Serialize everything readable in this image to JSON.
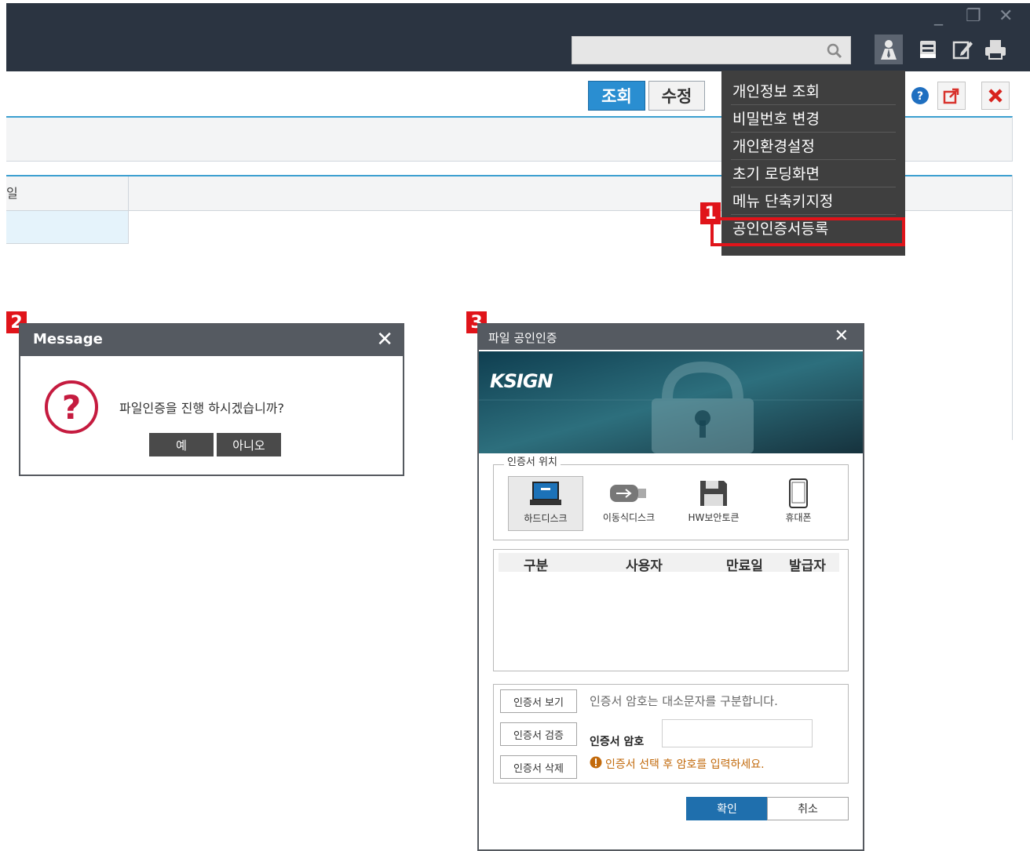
{
  "window_controls": {
    "minimize": "_",
    "restore": "❐",
    "close": "✕"
  },
  "search": {
    "placeholder": ""
  },
  "toolbar": {
    "query_label": "조회",
    "edit_label": "수정"
  },
  "panel": {
    "column_header_partial": "일"
  },
  "user_menu": {
    "items": [
      {
        "label": "개인정보 조회"
      },
      {
        "label": "비밀번호 변경"
      },
      {
        "label": "개인환경설정"
      },
      {
        "label": "초기 로딩화면"
      },
      {
        "label": "메뉴 단축키지정"
      },
      {
        "label": "공인인증서등록"
      }
    ]
  },
  "steps": {
    "one": "1",
    "two": "2",
    "three": "3"
  },
  "message_dialog": {
    "title": "Message",
    "close": "✕",
    "text": "파일인증을 진행 하시겠습니까?",
    "yes_label": "예",
    "no_label": "아니오"
  },
  "cert_dialog": {
    "title": "파일 공인인증",
    "close": "✕",
    "logo": "KSIGN",
    "location_legend": "인증서 위치",
    "locations": [
      {
        "label": "하드디스크",
        "icon": "laptop-icon",
        "selected": true
      },
      {
        "label": "이동식디스크",
        "icon": "usb-icon",
        "selected": false
      },
      {
        "label": "HW보안토큰",
        "icon": "floppy-icon",
        "selected": false
      },
      {
        "label": "휴대폰",
        "icon": "phone-icon",
        "selected": false
      }
    ],
    "table_headers": [
      "구분",
      "사용자",
      "만료일",
      "발급자"
    ],
    "view_cert": "인증서 보기",
    "verify_cert": "인증서 검증",
    "delete_cert": "인증서 삭제",
    "case_note": "인증서 암호는 대소문자를 구분합니다.",
    "password_label": "인증서 암호",
    "password_value": "",
    "hint": "인증서 선택 후 암호를 입력하세요.",
    "ok_label": "확인",
    "cancel_label": "취소"
  },
  "colors": {
    "accent_blue": "#2a8ed1",
    "highlight_red": "#e0141a",
    "topbar": "#2b3441",
    "menu_bg": "#3f3f3f",
    "dialog_title": "#555a61"
  }
}
